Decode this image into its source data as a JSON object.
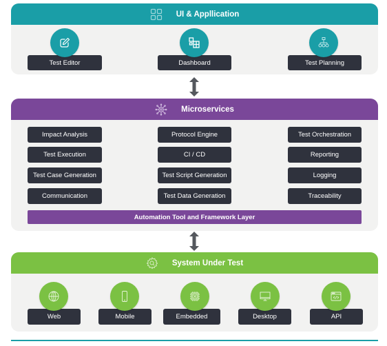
{
  "ui_layer": {
    "title": "UI & Appllication",
    "header_icon": "grid-icon",
    "color": "#1a9ea7",
    "items": [
      {
        "label": "Test Editor",
        "icon": "edit-icon"
      },
      {
        "label": "Dashboard",
        "icon": "dashboard-icon"
      },
      {
        "label": "Test Planning",
        "icon": "hierarchy-icon"
      }
    ]
  },
  "microservices_layer": {
    "title": "Microservices",
    "header_icon": "network-hub-icon",
    "color": "#7a4799",
    "columns": [
      [
        "Impact Analysis",
        "Test Execution",
        "Test Case Generation",
        "Communication"
      ],
      [
        "Protocol Engine",
        "CI / CD",
        "Test Script Generation",
        "Test Data Generation"
      ],
      [
        "Test Orchestration",
        "Reporting",
        "Logging",
        "Traceability"
      ]
    ],
    "framework_bar": "Automation Tool and Framework Layer"
  },
  "sut_layer": {
    "title": "System Under Test",
    "header_icon": "gear-search-icon",
    "color": "#7bc143",
    "items": [
      {
        "label": "Web",
        "icon": "globe-icon"
      },
      {
        "label": "Mobile",
        "icon": "mobile-icon"
      },
      {
        "label": "Embedded",
        "icon": "chip-icon"
      },
      {
        "label": "Desktop",
        "icon": "monitor-icon"
      },
      {
        "label": "API",
        "icon": "api-window-icon"
      }
    ]
  },
  "connectors": {
    "arrow_icon": "double-arrow-icon",
    "arrow_color": "#55585e",
    "box_color": "#2f323d",
    "panel_bg": "#f2f2f1"
  }
}
